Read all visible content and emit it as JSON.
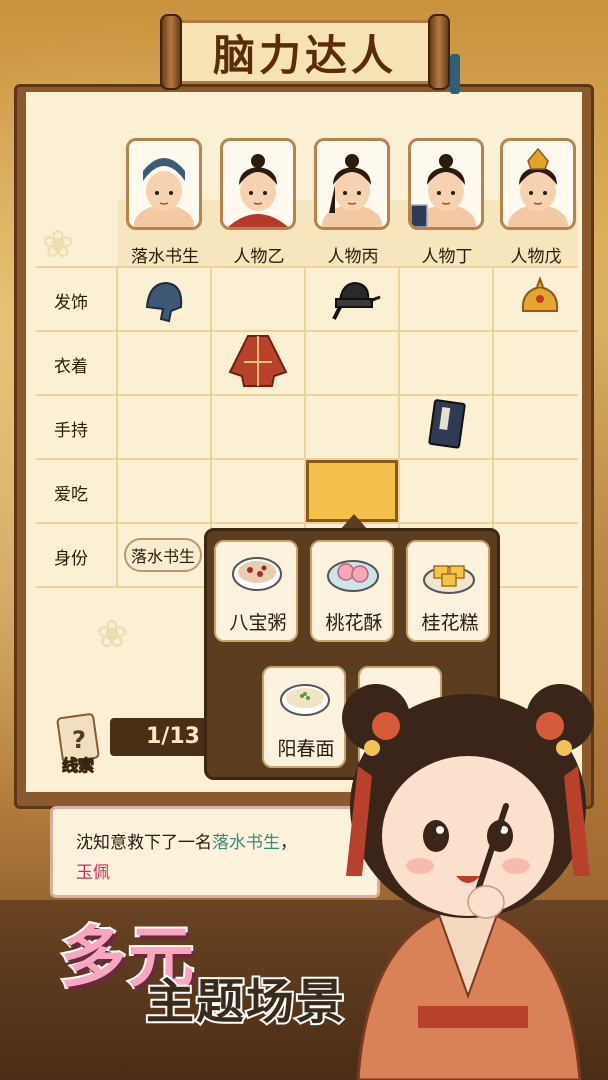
{
  "game": {
    "title": "脑力达人"
  },
  "characters": [
    {
      "name": "落水书生",
      "headwear": "blue-scholar-cap"
    },
    {
      "name": "人物乙",
      "headwear": "hair-bun"
    },
    {
      "name": "人物丙",
      "headwear": "black-official-hat"
    },
    {
      "name": "人物丁",
      "headwear": "hair-bun"
    },
    {
      "name": "人物戊",
      "headwear": "gold-crown"
    }
  ],
  "rows": [
    {
      "label": "发饰"
    },
    {
      "label": "衣着"
    },
    {
      "label": "手持"
    },
    {
      "label": "爱吃"
    },
    {
      "label": "身份"
    }
  ],
  "identity_chip": "落水书生",
  "food_options": [
    {
      "label": "八宝粥",
      "icon": "congee-bowl-icon"
    },
    {
      "label": "桃花酥",
      "icon": "peach-pastry-icon"
    },
    {
      "label": "桂花糕",
      "icon": "osmanthus-cake-icon"
    },
    {
      "label": "阳春面",
      "icon": "noodle-bowl-icon"
    }
  ],
  "progress": {
    "text": "1/13"
  },
  "clue": {
    "label": "线索"
  },
  "dialog": {
    "part1": "沈知意救下了一名",
    "highlight1": "落水书生",
    "part2": "，",
    "highlight2": "玉佩"
  },
  "promo": {
    "line1": "多元",
    "line2": "主题场景"
  },
  "colors": {
    "accent_gold": "#f5c04a",
    "board_brown": "#8a5a2e",
    "paper": "#fbf0d4",
    "promo_pink": "#f9a7c0"
  }
}
